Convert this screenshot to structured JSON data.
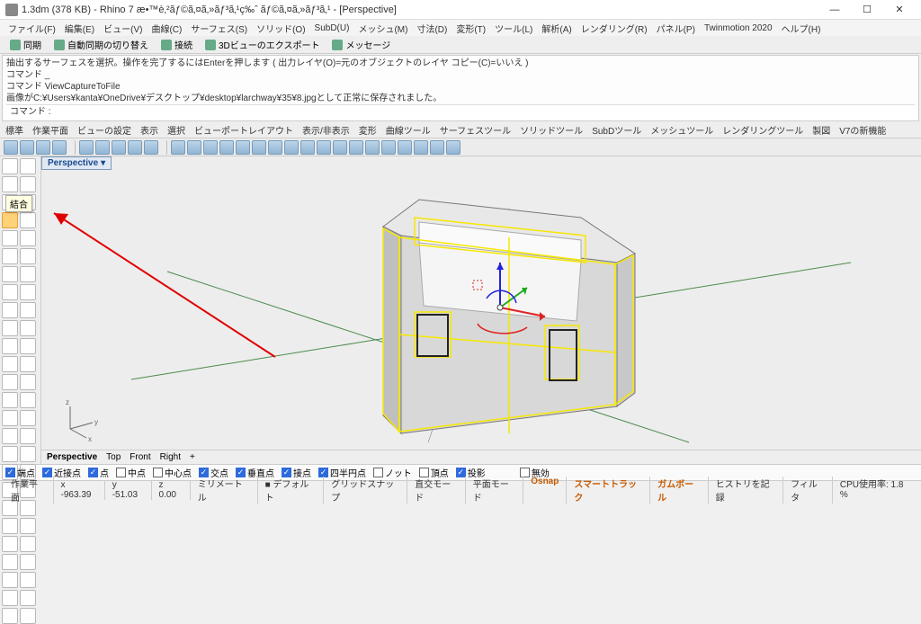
{
  "titlebar": {
    "title": "1.3dm (378 KB) - Rhino 7 æ•™è‚²ãƒ©ã‚¤ã‚»ãƒ³ã‚¹ç‰ˆ ãƒ©ã‚¤ã‚»ãƒ³ã‚¹ - [Perspective]"
  },
  "menubar": {
    "items": [
      "ファイル(F)",
      "編集(E)",
      "ビュー(V)",
      "曲線(C)",
      "サーフェス(S)",
      "ソリッド(O)",
      "SubD(U)",
      "メッシュ(M)",
      "寸法(D)",
      "変形(T)",
      "ツール(L)",
      "解析(A)",
      "レンダリング(R)",
      "パネル(P)",
      "Twinmotion 2020",
      "ヘルプ(H)"
    ]
  },
  "toolbar1": {
    "items": [
      "同期",
      "自動同期の切り替え",
      "接続",
      "3Dビューのエクスポート",
      "メッセージ"
    ]
  },
  "cmdhistory": [
    "抽出するサーフェスを選択。操作を完了するにはEnterを押します ( 出力レイヤ(O)=元のオブジェクトのレイヤ  コピー(C)=いいえ )",
    "コマンド _",
    "コマンド  ViewCaptureToFile",
    "画像がC:¥Users¥kanta¥OneDrive¥デスクトップ¥desktop¥larchway¥35¥8.jpgとして正常に保存されました。"
  ],
  "cmdprompt": "コマンド :",
  "tabbar": {
    "items": [
      "標準",
      "作業平面",
      "ビューの設定",
      "表示",
      "選択",
      "ビューポートレイアウト",
      "表示/非表示",
      "変形",
      "曲線ツール",
      "サーフェスツール",
      "ソリッドツール",
      "SubDツール",
      "メッシュツール",
      "レンダリングツール",
      "製図",
      "V7の新機能"
    ]
  },
  "tooltip": "結合",
  "viewport": {
    "label": "Perspective",
    "tabs": [
      "Perspective",
      "Top",
      "Front",
      "Right",
      "+"
    ]
  },
  "axes": {
    "x": "x",
    "y": "y",
    "z": "z"
  },
  "osnaps": {
    "items": [
      {
        "label": "端点",
        "on": true
      },
      {
        "label": "近接点",
        "on": true
      },
      {
        "label": "点",
        "on": true
      },
      {
        "label": "中点",
        "on": false
      },
      {
        "label": "中心点",
        "on": false
      },
      {
        "label": "交点",
        "on": true
      },
      {
        "label": "垂直点",
        "on": true
      },
      {
        "label": "接点",
        "on": true
      },
      {
        "label": "四半円点",
        "on": true
      },
      {
        "label": "ノット",
        "on": false
      },
      {
        "label": "頂点",
        "on": false
      },
      {
        "label": "投影",
        "on": true
      }
    ],
    "disable": "無効"
  },
  "status": {
    "plane": "作業平面",
    "x": "x -963.39",
    "y": "y -51.03",
    "z": "z 0.00",
    "units": "ミリメートル",
    "layer": "デフォルト",
    "grid": "グリッドスナップ",
    "ortho": "直交モード",
    "planar": "平面モード",
    "osnap": "Osnap",
    "smart": "スマートトラック",
    "gumball": "ガムボール",
    "record": "ヒストリを記録",
    "filter": "フィルタ",
    "cpu": "CPU使用率: 1.8 %"
  },
  "winbtns": {
    "min": "—",
    "max": "☐",
    "close": "✕"
  }
}
